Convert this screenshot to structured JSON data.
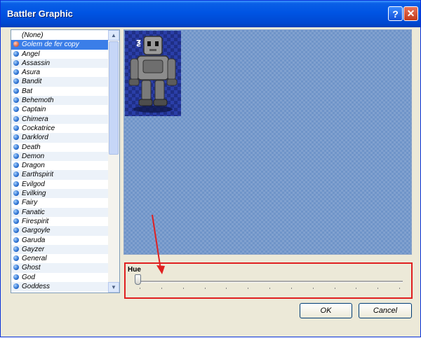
{
  "window": {
    "title": "Battler Graphic"
  },
  "titlebar_buttons": {
    "help": "?",
    "close": "✕"
  },
  "list": {
    "items": [
      {
        "label": "(None)",
        "state": "none"
      },
      {
        "label": "Golem de fer copy",
        "state": "selected"
      },
      {
        "label": "Angel"
      },
      {
        "label": "Assassin"
      },
      {
        "label": "Asura"
      },
      {
        "label": "Bandit"
      },
      {
        "label": "Bat"
      },
      {
        "label": "Behemoth"
      },
      {
        "label": "Captain"
      },
      {
        "label": "Chimera"
      },
      {
        "label": "Cockatrice"
      },
      {
        "label": "Darklord"
      },
      {
        "label": "Death"
      },
      {
        "label": "Demon"
      },
      {
        "label": "Dragon"
      },
      {
        "label": "Earthspirit"
      },
      {
        "label": "Evilgod"
      },
      {
        "label": "Evilking"
      },
      {
        "label": "Fairy"
      },
      {
        "label": "Fanatic"
      },
      {
        "label": "Firespirit"
      },
      {
        "label": "Gargoyle"
      },
      {
        "label": "Garuda"
      },
      {
        "label": "Gayzer"
      },
      {
        "label": "General"
      },
      {
        "label": "Ghost"
      },
      {
        "label": "God"
      },
      {
        "label": "Goddess"
      }
    ],
    "scroll_up_icon": "▲",
    "scroll_down_icon": "▼"
  },
  "hue": {
    "label": "Hue",
    "value": 0,
    "tick_count": 13
  },
  "buttons": {
    "ok": "OK",
    "cancel": "Cancel"
  },
  "colors": {
    "accent_annotation": "#e02020",
    "selection": "#3b7ee8",
    "titlebar": "#0054e3"
  }
}
